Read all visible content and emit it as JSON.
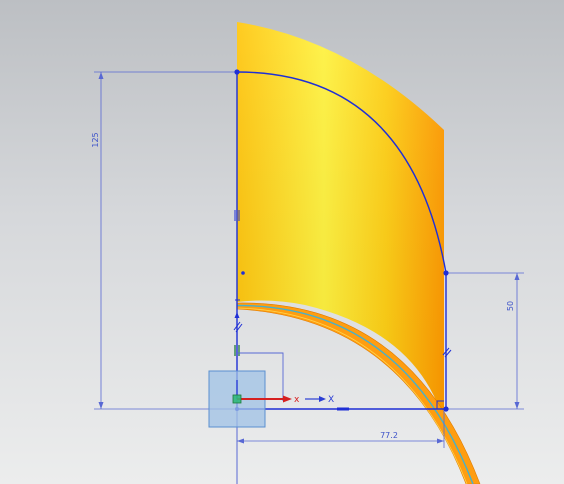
{
  "viewport": {
    "background_top": "#bcbfc3",
    "background_bottom": "#eceded"
  },
  "colors": {
    "sketch_line": "#1f2fd6",
    "dimension_line": "#5868d4",
    "dimension_text": "#3d52c9",
    "body_light": "#fff03a",
    "body_mid": "#ffd21a",
    "body_dark": "#ff9800",
    "csys_x_red": "#d62020",
    "csys_x_blue": "#2b3ed4",
    "selection_box": "#9fc1e6"
  },
  "dimensions": {
    "height_total": "125",
    "height_right": "50",
    "width_bottom": "77.2"
  },
  "axes": {
    "x_label_red": "x",
    "x_label_blue": "X"
  }
}
